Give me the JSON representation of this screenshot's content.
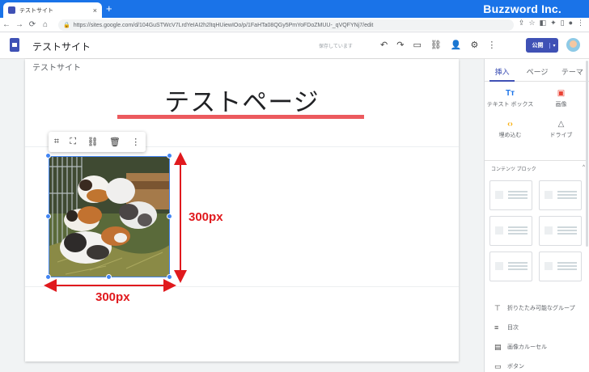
{
  "browser": {
    "tab_title": "テストサイト",
    "tab_close": "×",
    "new_tab": "+",
    "brand": "Buzzword Inc.",
    "url": "https://sites.google.com/d/104GuSTWcV7LrdYeIAI2h2ltqHUiewIOo/p/1FaHTa08QGy5PmYoFDoZMUU-_qVQFYNj7/edit",
    "nav": {
      "back": "←",
      "forward": "→",
      "reload": "⟳",
      "home": "⌂"
    }
  },
  "toolbar": {
    "site_name": "テストサイト",
    "saving_status": "保存しています",
    "icons": {
      "undo": "↶",
      "redo": "↷",
      "preview": "▭",
      "link": "⛓",
      "share": "👤",
      "settings": "⚙",
      "more": "⋮"
    },
    "publish_label": "公開",
    "publish_dropdown": "▾"
  },
  "page": {
    "site_name": "テストサイト",
    "title": "テストページ",
    "image_toolbar": {
      "crop": "⌗",
      "fullscreen": "⛶",
      "link": "⛓",
      "delete": "🗑",
      "more": "⋮"
    }
  },
  "annotations": {
    "height_label": "300px",
    "width_label": "300px",
    "arrow_color": "#e0191d"
  },
  "panel": {
    "tabs": [
      "挿入",
      "ページ",
      "テーマ"
    ],
    "insert_items": [
      {
        "icon": "Tт",
        "label": "テキスト ボックス",
        "icon_color": "#1a73e8"
      },
      {
        "icon": "▣",
        "label": "画像",
        "icon_color": "#ea4335"
      },
      {
        "icon": "‹›",
        "label": "埋め込む",
        "icon_color": "#f9ab00"
      },
      {
        "icon": "△",
        "label": "ドライブ",
        "icon_color": "#5f6368"
      }
    ],
    "content_blocks_heading": "コンテンツ ブロック",
    "content_blocks_toggle": "^",
    "list_items": [
      {
        "icon": "⊤",
        "label": "折りたたみ可能なグループ"
      },
      {
        "icon": "≡",
        "label": "目次"
      },
      {
        "icon": "▤",
        "label": "画像カルーセル"
      },
      {
        "icon": "▭",
        "label": "ボタン"
      }
    ]
  },
  "colors": {
    "chrome_blue": "#1a73e8",
    "sites_indigo": "#3f51b5",
    "title_underline": "#ec5a5e"
  }
}
